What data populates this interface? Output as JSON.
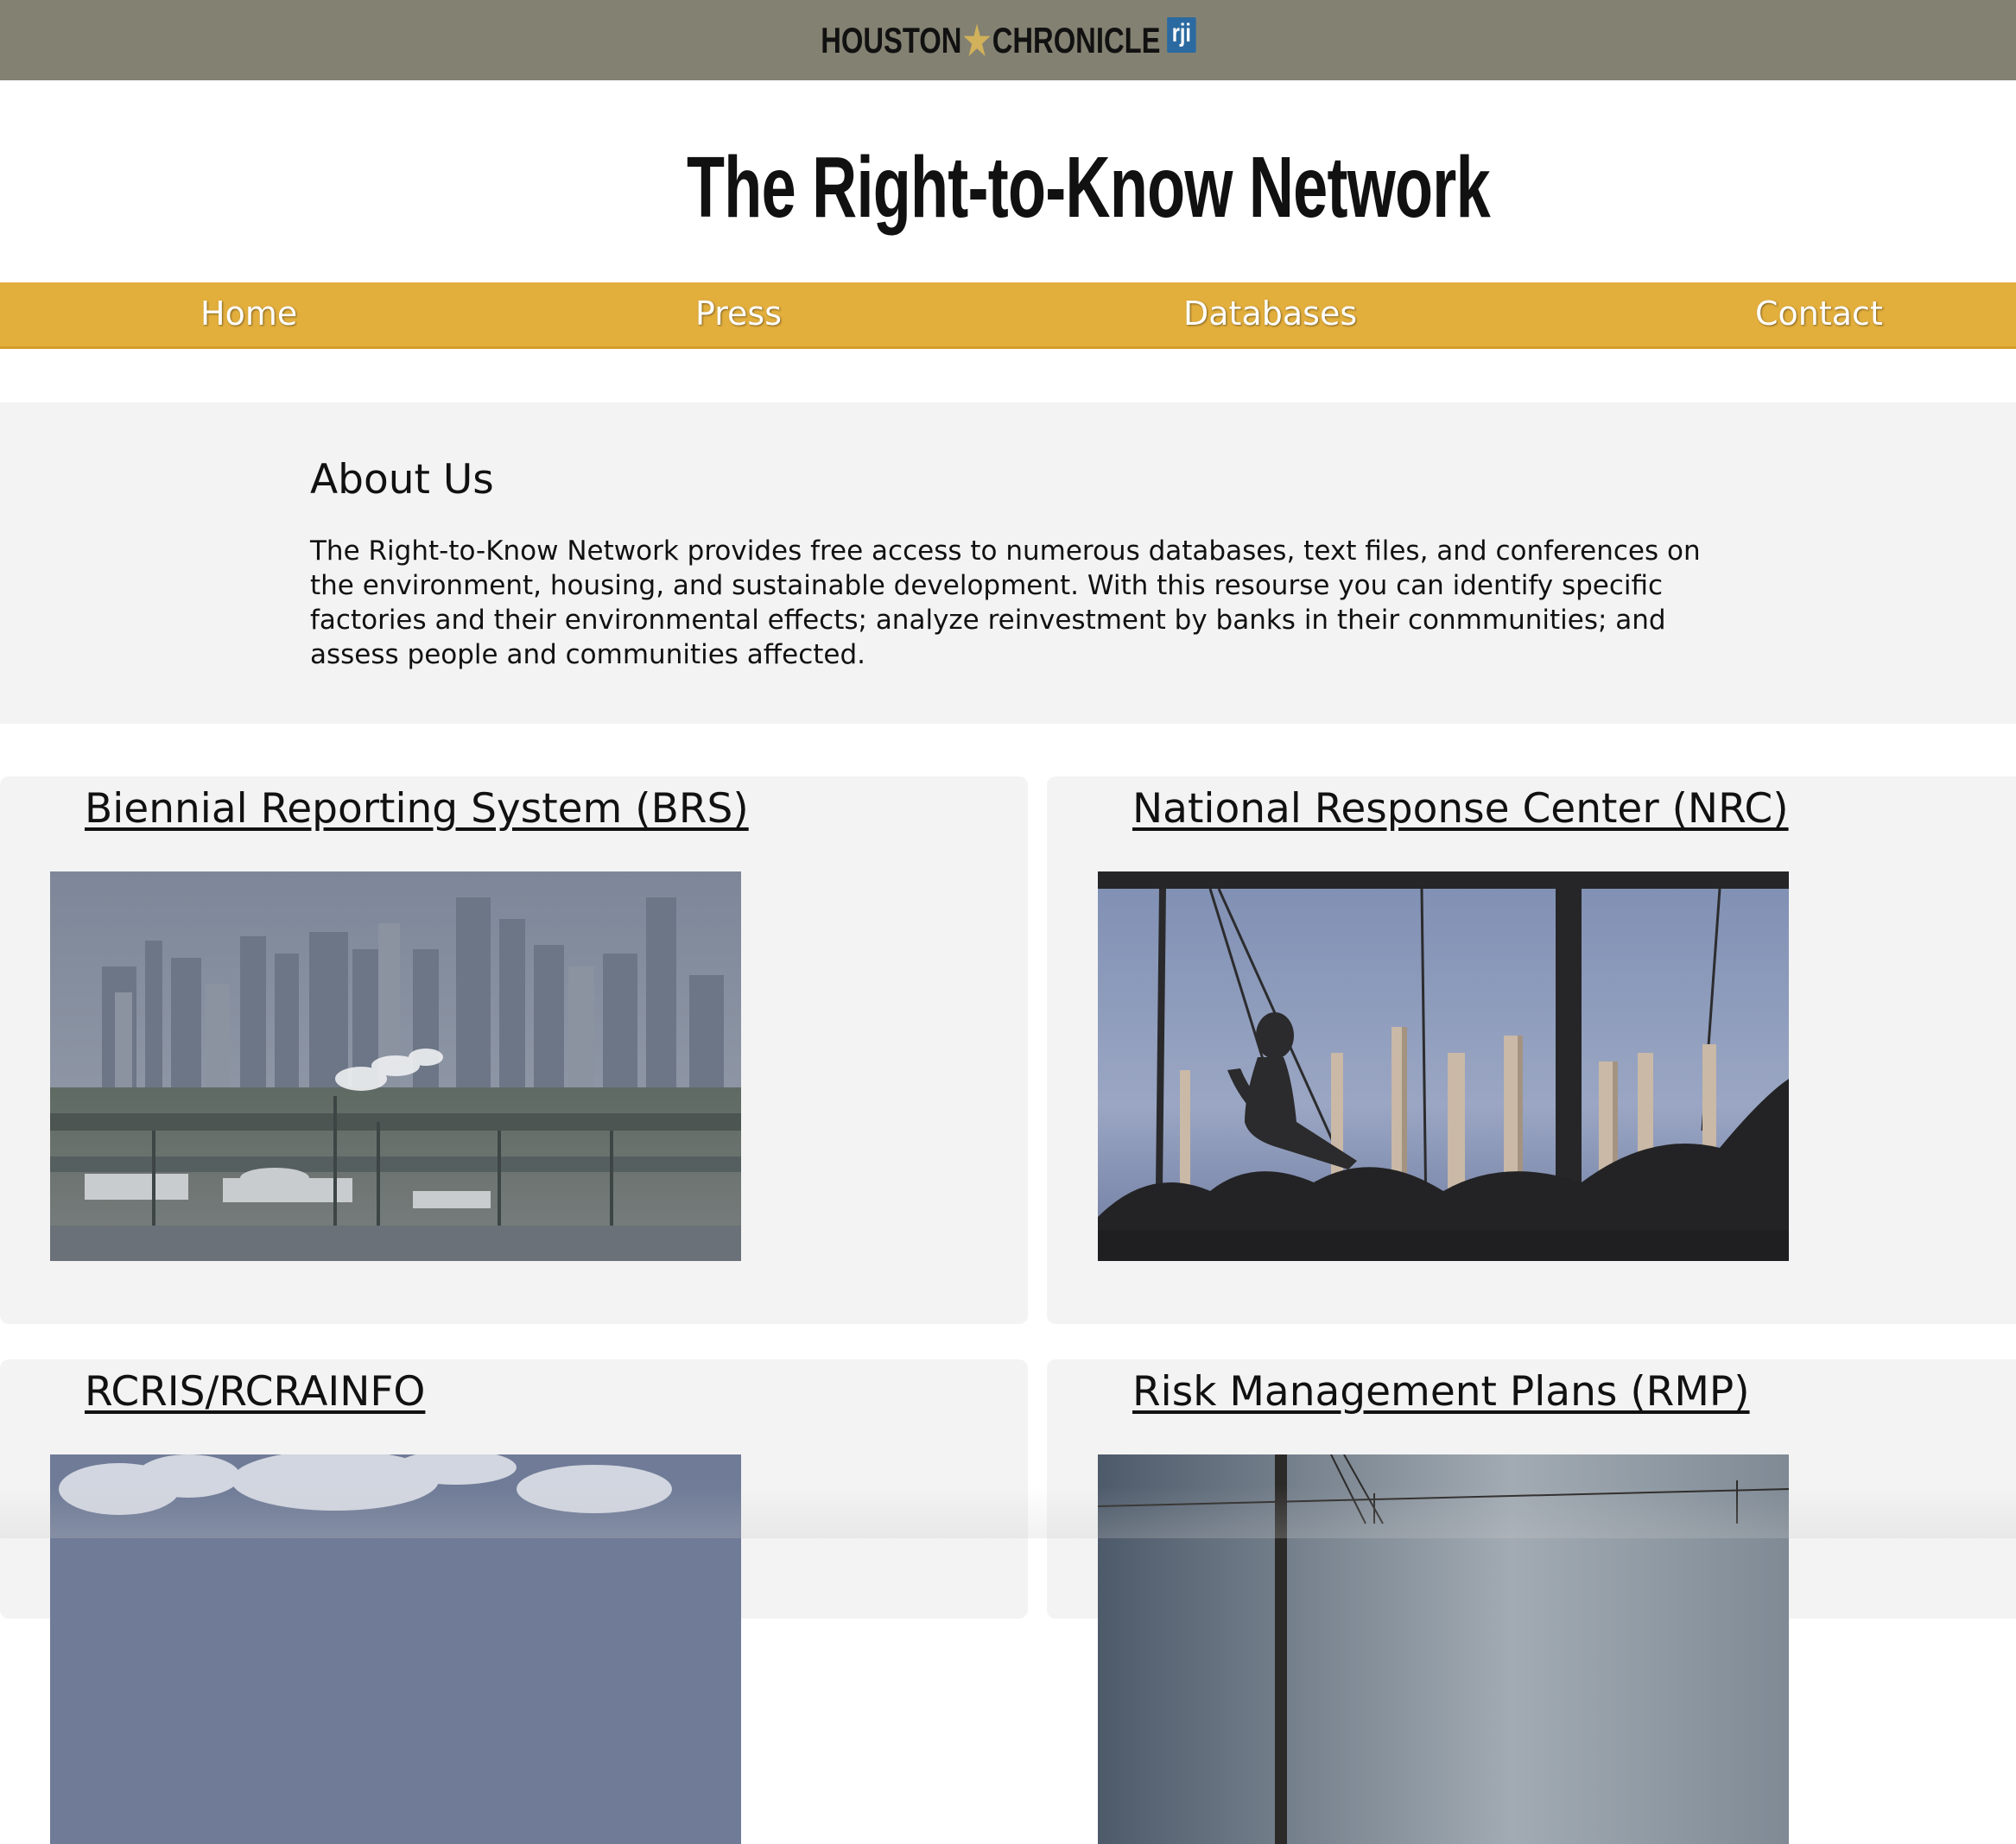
{
  "brand": {
    "left": "HOUSTON",
    "star": "★",
    "right": "CHRONICLE",
    "badge": "rji"
  },
  "site_title": "The Right-to-Know Network",
  "nav": {
    "items": [
      "Home",
      "Press",
      "Databases",
      "Contact"
    ]
  },
  "about": {
    "heading": "About Us",
    "body": "The Right-to-Know Network provides free access to numerous databases, text files, and conferences on the environment, housing, and sustainable development. With this resourse you can identify specific factories and their environmental effects; analyze reinvestment by banks in their conmmunities; and assess people and communities affected."
  },
  "databases": [
    {
      "title": "Biennial Reporting System (BRS)",
      "image": "houston-skyline-refinery-photo"
    },
    {
      "title": "National Response Center (NRC)",
      "image": "child-swing-refinery-photo"
    },
    {
      "title": "RCRIS/RCRAINFO",
      "image": "cloudy-sky-photo"
    },
    {
      "title": "Risk Management Plans (RMP)",
      "image": "power-lines-dusk-photo"
    }
  ],
  "colors": {
    "brandbar": "#838172",
    "nav": "#e2ae3c",
    "panel": "#f3f3f3",
    "rji_badge": "#2b6aa0"
  }
}
